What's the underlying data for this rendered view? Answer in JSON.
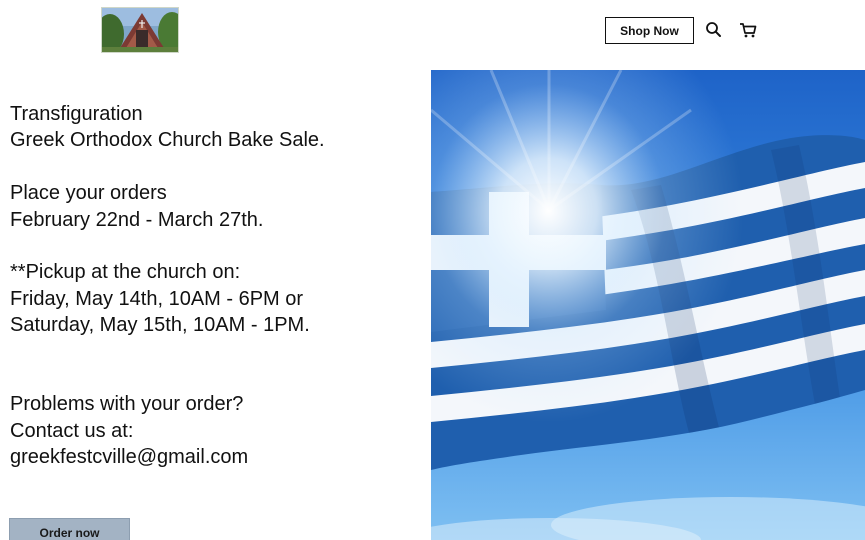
{
  "header": {
    "shop_button_label": "Shop Now",
    "icons": [
      "search-icon",
      "cart-icon"
    ]
  },
  "content": {
    "title_line1": "Transfiguration",
    "title_line2": "Greek Orthodox Church Bake Sale.",
    "orders_line1": "Place your orders",
    "orders_line2": "February 22nd - March 27th.",
    "pickup_line1": "**Pickup at the church on:",
    "pickup_line2": "Friday, May 14th, 10AM - 6PM or",
    "pickup_line3": "Saturday, May 15th, 10AM - 1PM.",
    "contact_line1": "Problems with your order?",
    "contact_line2": "Contact us at:",
    "contact_email": "greekfestcville@gmail.com",
    "order_button_label": "Order now"
  },
  "colors": {
    "flag_blue": "#1f5fae",
    "sky": "#4a97e4",
    "button_bg": "#a3b3c4"
  }
}
